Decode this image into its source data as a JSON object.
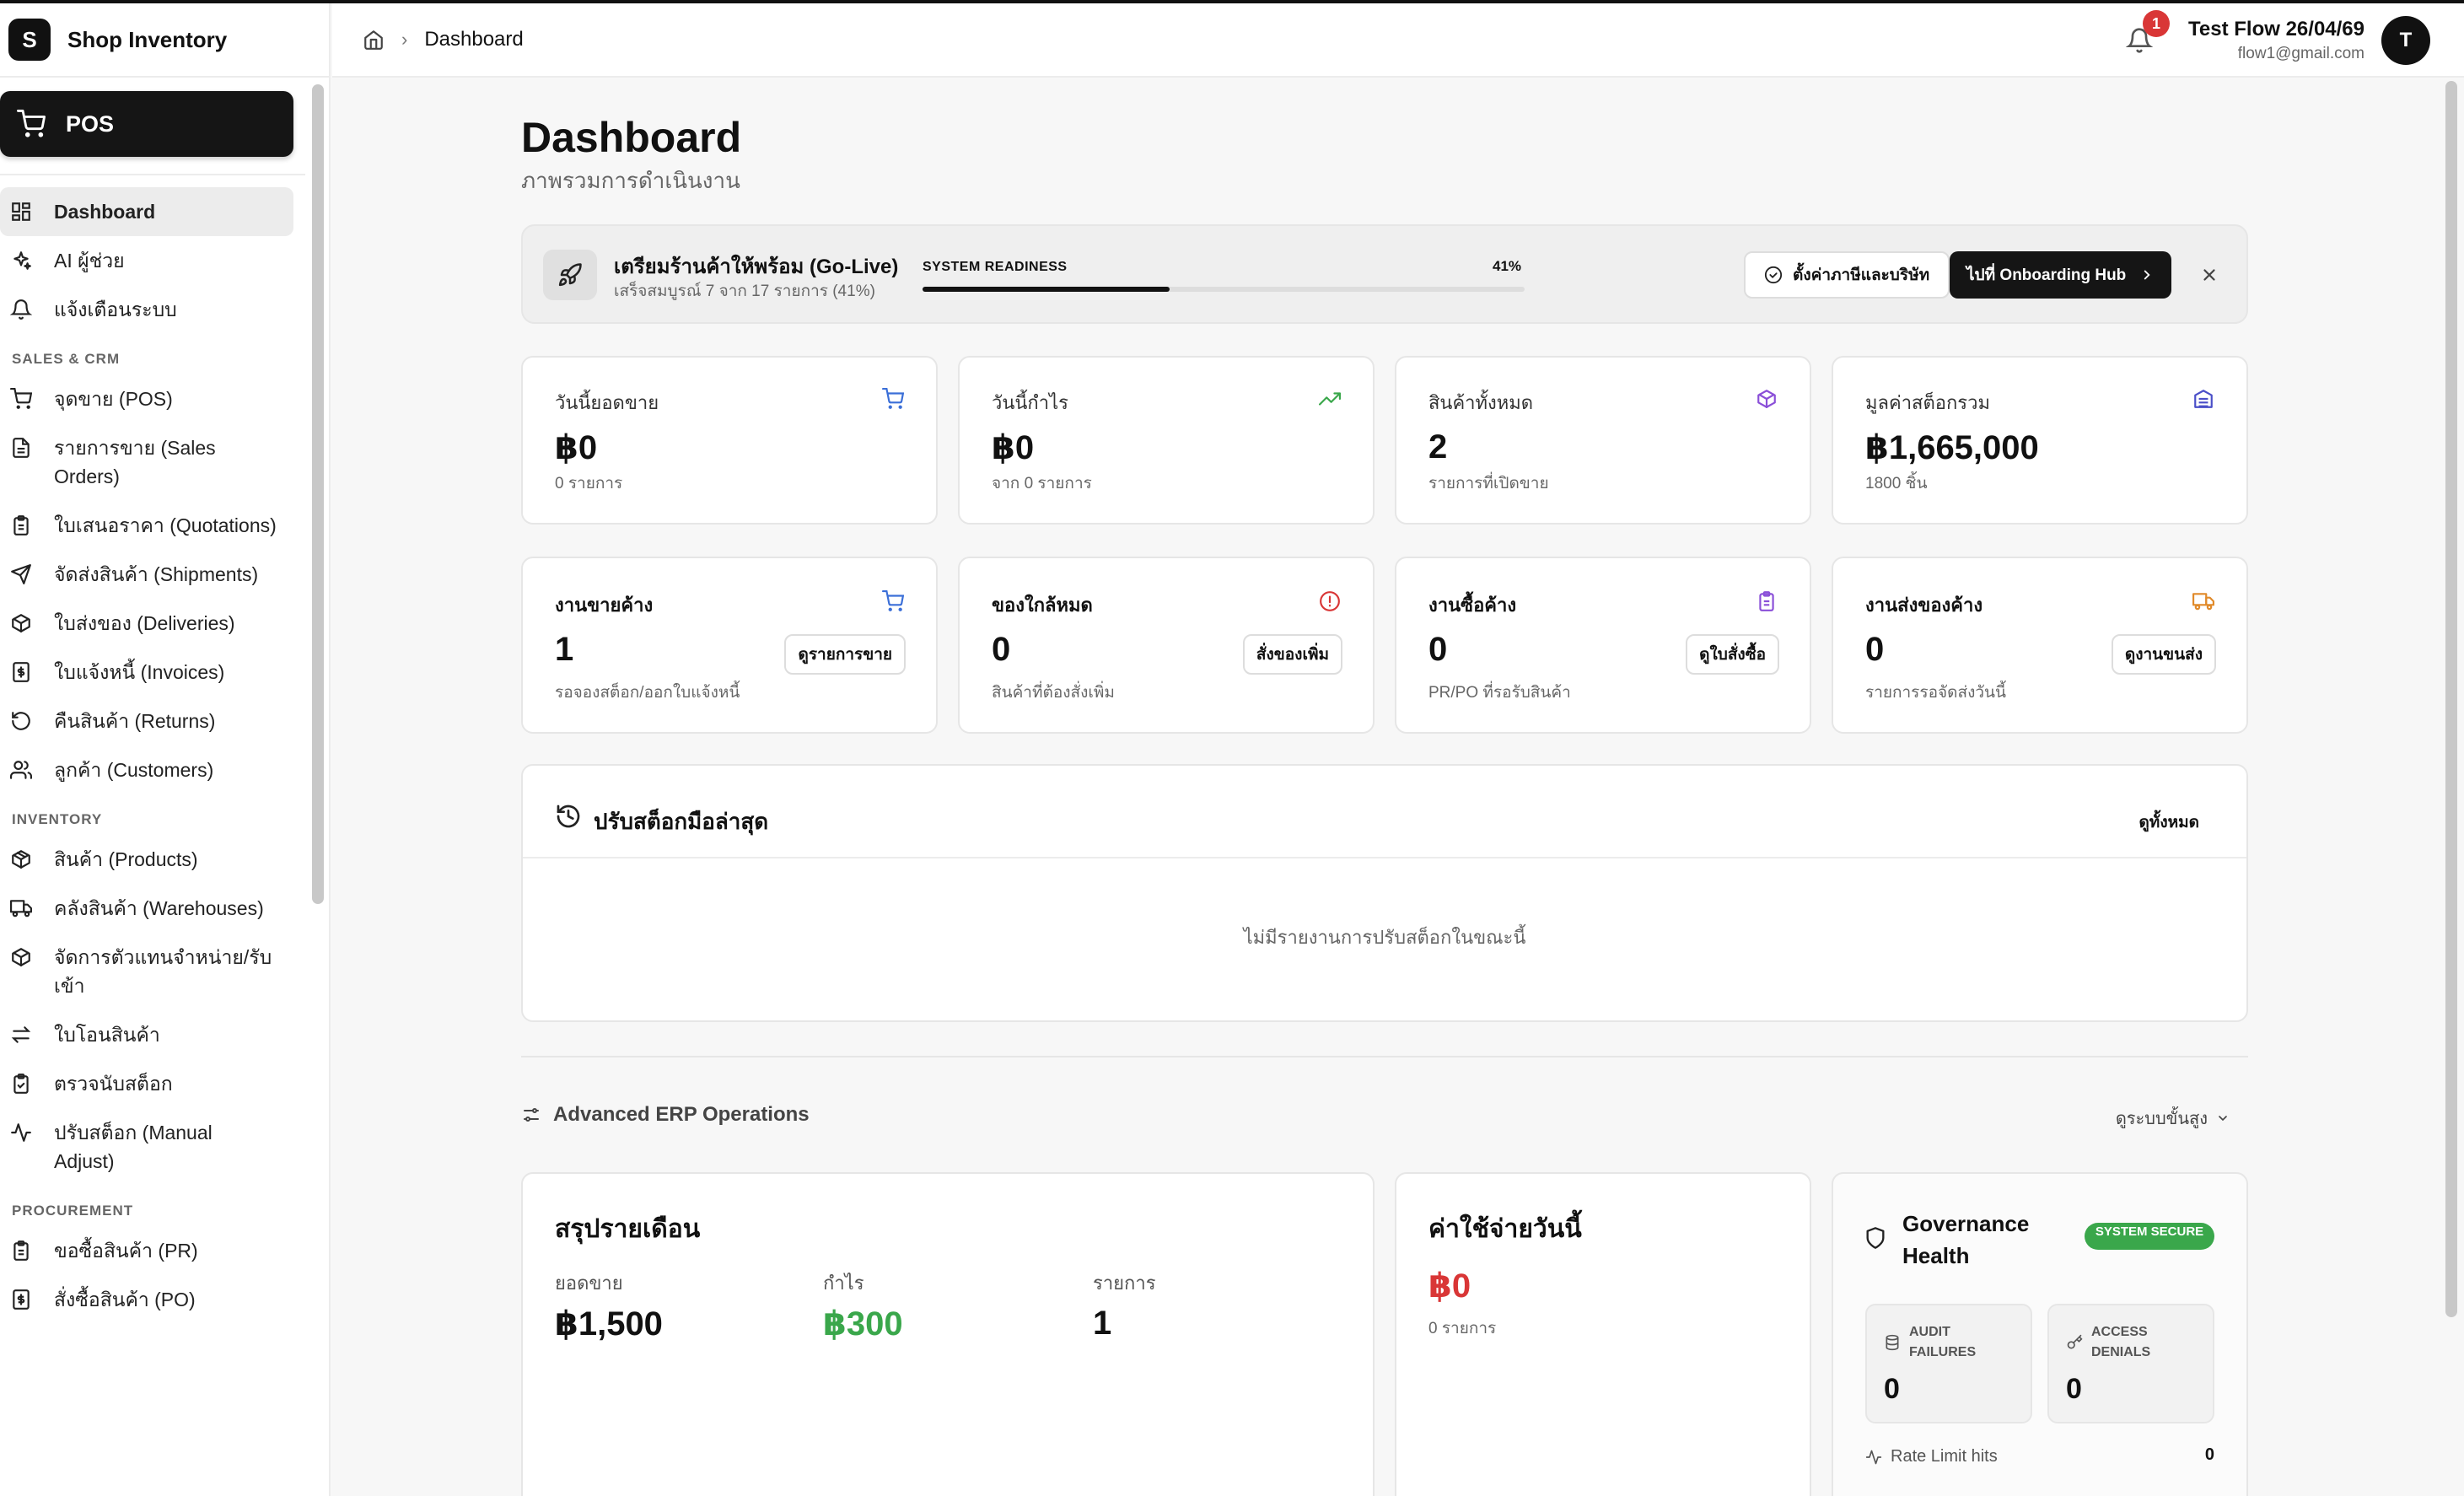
{
  "brand": {
    "logo_letter": "S",
    "name": "Shop Inventory"
  },
  "sidebar": {
    "pos_label": "POS",
    "top_items": [
      {
        "label": "Dashboard",
        "icon": "dashboard-icon"
      },
      {
        "label": "AI ผู้ช่วย",
        "icon": "sparkles-icon"
      },
      {
        "label": "แจ้งเตือนระบบ",
        "icon": "bell-icon"
      }
    ],
    "sections": [
      {
        "title": "SALES & CRM",
        "items": [
          {
            "label": "จุดขาย (POS)",
            "icon": "cart-icon"
          },
          {
            "label": "รายการขาย (Sales Orders)",
            "icon": "document-icon"
          },
          {
            "label": "ใบเสนอราคา (Quotations)",
            "icon": "clipboard-icon"
          },
          {
            "label": "จัดส่งสินค้า (Shipments)",
            "icon": "send-icon"
          },
          {
            "label": "ใบส่งของ (Deliveries)",
            "icon": "package-icon"
          },
          {
            "label": "ใบแจ้งหนี้ (Invoices)",
            "icon": "invoice-icon"
          },
          {
            "label": "คืนสินค้า (Returns)",
            "icon": "return-icon"
          },
          {
            "label": "ลูกค้า (Customers)",
            "icon": "users-icon"
          }
        ]
      },
      {
        "title": "INVENTORY",
        "items": [
          {
            "label": "สินค้า (Products)",
            "icon": "box-icon"
          },
          {
            "label": "คลังสินค้า (Warehouses)",
            "icon": "truck-icon"
          },
          {
            "label": "จัดการตัวแทนจำหน่าย/รับเข้า",
            "icon": "package-icon"
          },
          {
            "label": "ใบโอนสินค้า",
            "icon": "transfer-icon"
          },
          {
            "label": "ตรวจนับสต็อก",
            "icon": "clipboard-check-icon"
          },
          {
            "label": "ปรับสต็อก (Manual Adjust)",
            "icon": "activity-icon"
          }
        ]
      },
      {
        "title": "PROCUREMENT",
        "items": [
          {
            "label": "ขอซื้อสินค้า (PR)",
            "icon": "clipboard-icon"
          },
          {
            "label": "สั่งซื้อสินค้า (PO)",
            "icon": "invoice-icon"
          }
        ]
      }
    ]
  },
  "header": {
    "breadcrumb": "Dashboard",
    "notification_count": "1",
    "user_name": "Test Flow 26/04/69",
    "user_email": "flow1@gmail.com",
    "avatar_letter": "T"
  },
  "page": {
    "title": "Dashboard",
    "subtitle": "ภาพรวมการดำเนินงาน"
  },
  "golive": {
    "title": "เตรียมร้านค้าให้พร้อม (Go-Live)",
    "subtitle": "เสร็จสมบูรณ์ 7 จาก 17 รายการ (41%)",
    "readiness_label": "SYSTEM READINESS",
    "readiness_pct": "41%",
    "readiness_value": 41,
    "settings_button": "ตั้งค่าภาษีและบริษัท",
    "hub_button": "ไปที่ Onboarding Hub"
  },
  "stats": [
    {
      "label": "วันนี้ยอดขาย",
      "value": "฿0",
      "sub": "0 รายการ",
      "icon": "cart-icon",
      "color": "#3b6fd8"
    },
    {
      "label": "วันนี้กำไร",
      "value": "฿0",
      "sub": "จาก 0 รายการ",
      "icon": "trending-up-icon",
      "color": "#3aa74b"
    },
    {
      "label": "สินค้าทั้งหมด",
      "value": "2",
      "sub": "รายการที่เปิดขาย",
      "icon": "cube-icon",
      "color": "#8a4fd8"
    },
    {
      "label": "มูลค่าสต็อกรวม",
      "value": "฿1,665,000",
      "sub": "1800 ชิ้น",
      "icon": "warehouse-icon",
      "color": "#4a4fc8"
    }
  ],
  "tasks": [
    {
      "label": "งานขายค้าง",
      "value": "1",
      "sub": "รอจองสต็อก/ออกใบแจ้งหนี้",
      "button": "ดูรายการขาย",
      "icon": "cart-icon",
      "color": "#3b6fd8"
    },
    {
      "label": "ของใกล้หมด",
      "value": "0",
      "sub": "สินค้าที่ต้องสั่งเพิ่ม",
      "button": "สั่งของเพิ่ม",
      "icon": "alert-circle-icon",
      "color": "#d93636"
    },
    {
      "label": "งานซื้อค้าง",
      "value": "0",
      "sub": "PR/PO ที่รอรับสินค้า",
      "button": "ดูใบสั่งซื้อ",
      "icon": "clipboard-icon",
      "color": "#8a4fd8"
    },
    {
      "label": "งานส่งของค้าง",
      "value": "0",
      "sub": "รายการรอจัดส่งวันนี้",
      "button": "ดูงานขนส่ง",
      "icon": "truck-icon",
      "color": "#e08a2a"
    }
  ],
  "adjustments": {
    "title": "ปรับสต็อกมือล่าสุด",
    "view_all": "ดูทั้งหมด",
    "empty": "ไม่มีรายงานการปรับสต็อกในขณะนี้"
  },
  "erp": {
    "title": "Advanced ERP Operations",
    "toggle": "ดูระบบขั้นสูง"
  },
  "monthly": {
    "title": "สรุปรายเดือน",
    "sales_label": "ยอดขาย",
    "sales_value": "฿1,500",
    "profit_label": "กำไร",
    "profit_value": "฿300",
    "orders_label": "รายการ",
    "orders_value": "1"
  },
  "expense": {
    "title": "ค่าใช้จ่ายวันนี้",
    "value": "฿0",
    "sub": "0 รายการ"
  },
  "governance": {
    "title": "Governance Health",
    "badge": "SYSTEM SECURE",
    "audit_label": "AUDIT FAILURES",
    "audit_value": "0",
    "access_label": "ACCESS DENIALS",
    "access_value": "0",
    "rate_label": "Rate Limit hits",
    "rate_value": "0"
  },
  "colors": {
    "accent": "#151515",
    "danger": "#d93636",
    "success": "#3aa74b"
  }
}
